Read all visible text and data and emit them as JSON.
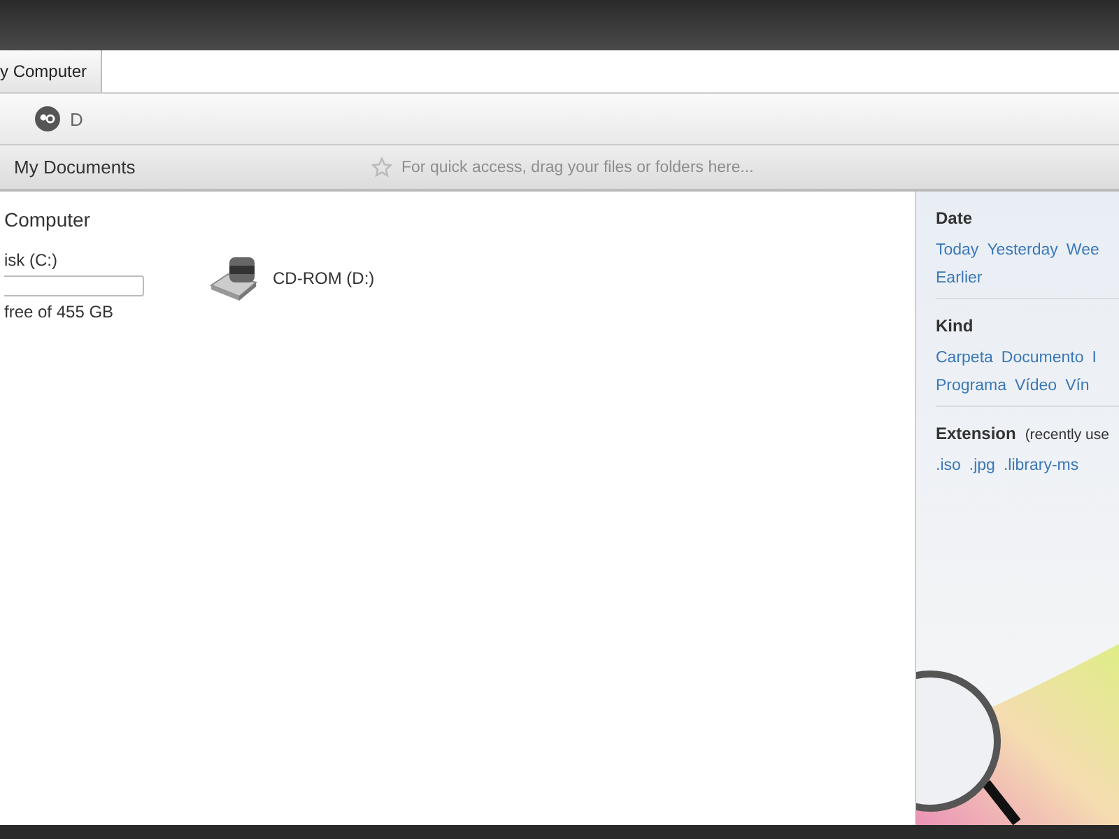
{
  "tabs": [
    {
      "label": "y Computer",
      "selected": true
    }
  ],
  "toolbar": {
    "drive_label": "D"
  },
  "bookmarks": {
    "items": [
      "My Documents"
    ],
    "placeholder": "For quick access, drag your files or folders here..."
  },
  "content": {
    "heading": "Computer",
    "drives": [
      {
        "kind": "disk",
        "name": "isk (C:)",
        "free": "free of 455 GB"
      },
      {
        "kind": "cdrom",
        "name": "CD-ROM (D:)"
      }
    ]
  },
  "filters": [
    {
      "title": "Date",
      "options": [
        "Today",
        "Yesterday",
        "Wee",
        "Earlier"
      ]
    },
    {
      "title": "Kind",
      "options": [
        "Carpeta",
        "Documento",
        "I",
        "Programa",
        "Vídeo",
        "Vín"
      ]
    },
    {
      "title": "Extension",
      "note": "(recently use",
      "options": [
        ".iso",
        ".jpg",
        ".library-ms"
      ]
    }
  ]
}
